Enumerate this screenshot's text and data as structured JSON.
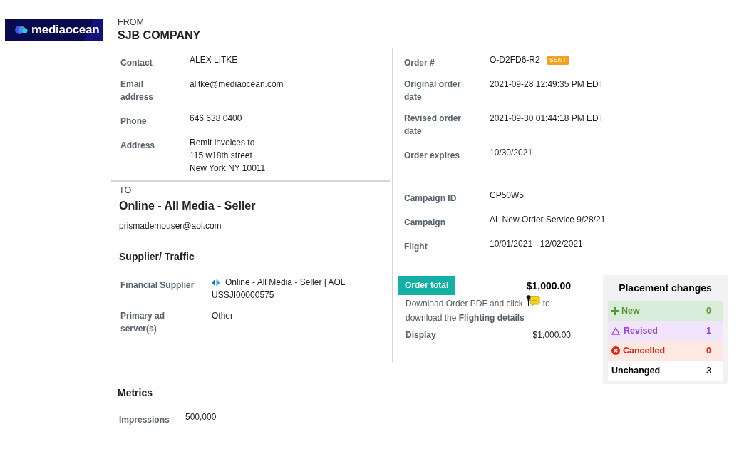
{
  "logo": {
    "text": "mediaocean"
  },
  "from": {
    "heading": "FROM",
    "company": "SJB COMPANY",
    "fields": [
      {
        "label": "Contact",
        "lines": [
          "ALEX LITKE"
        ]
      },
      {
        "label": "Email address",
        "lines": [
          "alitke@mediaocean.com"
        ]
      },
      {
        "label": "Phone",
        "lines": [
          "646 638 0400"
        ]
      },
      {
        "label": "Address",
        "lines": [
          "Remit invoices to",
          "115 w18th street",
          "New York NY 10011"
        ]
      }
    ]
  },
  "to": {
    "heading": "TO",
    "name": "Online - All Media - Seller",
    "email": "prismademouser@aol.com"
  },
  "supplier_traffic": {
    "title": "Supplier/ Traffic",
    "fields": [
      {
        "kind": "supplier",
        "label": "Financial Supplier",
        "lines": [
          "Online - All Media - Seller | AOL",
          "USSJI00000575"
        ]
      },
      {
        "kind": "text",
        "label": "Primary ad server(s)",
        "lines": [
          "Other"
        ]
      }
    ]
  },
  "order": {
    "details": [
      {
        "label": "Order #",
        "value": "O-D2FD6-R2",
        "badge": "SENT"
      },
      {
        "label": "Original order date",
        "value": "2021-09-28 12:49:35 PM EDT"
      },
      {
        "label": "Revised order date",
        "value": "2021-09-30 01:44:18 PM EDT"
      },
      {
        "label": "Order expires",
        "value": "10/30/2021"
      }
    ],
    "campaign": [
      {
        "label": "Campaign ID",
        "value": "CP50W5"
      },
      {
        "label": "Campaign",
        "value": "AL New Order Service 9/28/21"
      },
      {
        "label": "Flight",
        "value": "10/01/2021 - 12/02/2021"
      }
    ]
  },
  "order_total": {
    "label": "Order total",
    "amount": "$1,000.00",
    "instructions": {
      "before_icon": "Download Order PDF and click",
      "after_icon": "to",
      "second_line": "download the **Flighting details**"
    },
    "lines": [
      {
        "label": "Display",
        "amount": "$1,000.00"
      }
    ]
  },
  "placement_changes": {
    "title": "Placement changes",
    "rows": [
      {
        "kind": "new",
        "label": "New",
        "count": "0"
      },
      {
        "kind": "revised",
        "label": "Revised",
        "count": "1"
      },
      {
        "kind": "cancelled",
        "label": "Cancelled",
        "count": "0"
      },
      {
        "kind": "unchanged",
        "label": "Unchanged",
        "count": "3"
      }
    ]
  },
  "metrics": {
    "title": "Metrics",
    "fields": [
      {
        "label": "Impressions",
        "value": "500,000"
      }
    ]
  }
}
